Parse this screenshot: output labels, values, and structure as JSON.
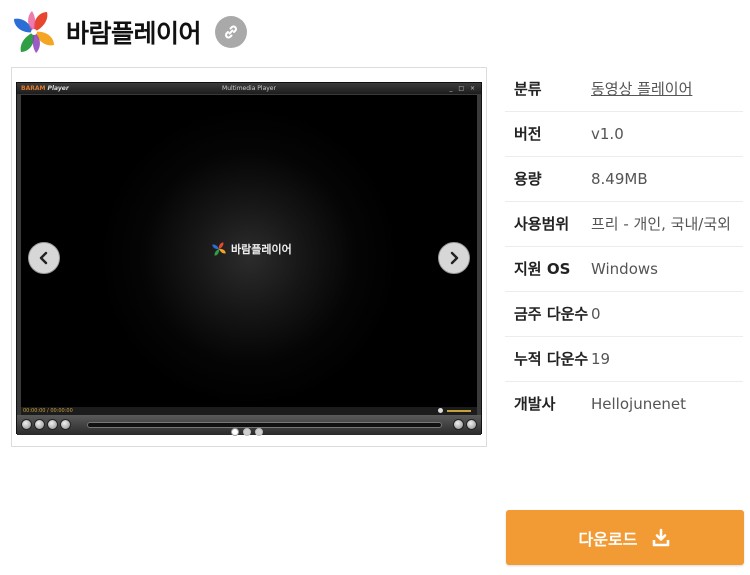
{
  "app": {
    "title": "바람플레이어"
  },
  "player": {
    "brand": "BARAM",
    "brand_suffix": "Player",
    "caption": "Multimedia Player",
    "window_buttons": "_ □ ×",
    "splash_name": "바람플레이어",
    "time": "00:00:00 / 00:00:00"
  },
  "carousel": {
    "total_slides": 3,
    "active_slide": 1
  },
  "info": {
    "rows": [
      {
        "label": "분류",
        "value": "동영상 플레이어",
        "link": true
      },
      {
        "label": "버전",
        "value": "v1.0"
      },
      {
        "label": "용량",
        "value": "8.49MB"
      },
      {
        "label": "사용범위",
        "value": "프리 - 개인, 국내/국외"
      },
      {
        "label": "지원 OS",
        "value": "Windows"
      },
      {
        "label": "금주 다운수",
        "value": "0"
      },
      {
        "label": "누적 다운수",
        "value": "19"
      },
      {
        "label": "개발사",
        "value": "Hellojunenet"
      }
    ]
  },
  "download": {
    "label": "다운로드"
  },
  "colors": {
    "accent": "#f29a33",
    "link_button": "#a9a9a9"
  },
  "icons": {
    "logo": "pinwheel-logo",
    "link": "link-icon",
    "prev": "chevron-left-icon",
    "next": "chevron-right-icon",
    "download": "download-icon"
  }
}
